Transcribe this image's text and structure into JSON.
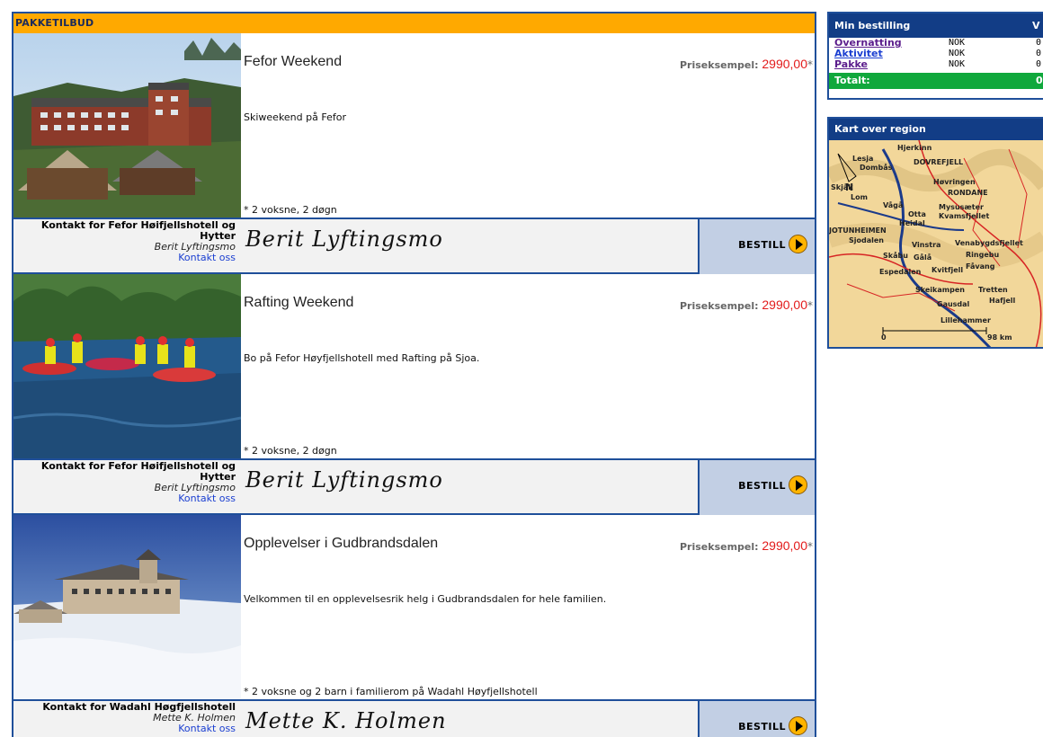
{
  "packages_header": "PAKKETILBUD",
  "packages": [
    {
      "title": "Fefor Weekend",
      "price_label": "Priseksempel:",
      "price_value": "2990,00",
      "price_star": "*",
      "description": "Skiweekend på Fefor",
      "note": "* 2 voksne, 2 døgn",
      "contact_for": "Kontakt for Fefor Høifjellshotell og Hytter",
      "contact_name": "Berit Lyftingsmo",
      "contact_link": "Kontakt oss",
      "signature": "Berit Lyftingsmo",
      "order_label": "BESTILL"
    },
    {
      "title": "Rafting Weekend",
      "price_label": "Priseksempel:",
      "price_value": "2990,00",
      "price_star": "*",
      "description": "Bo på Fefor Høyfjellshotell med Rafting på Sjoa.",
      "note": "* 2 voksne, 2 døgn",
      "contact_for": "Kontakt for Fefor Høifjellshotell og Hytter",
      "contact_name": "Berit Lyftingsmo",
      "contact_link": "Kontakt oss",
      "signature": "Berit Lyftingsmo",
      "order_label": "BESTILL"
    },
    {
      "title": "Opplevelser i Gudbrandsdalen",
      "price_label": "Priseksempel:",
      "price_value": "2990,00",
      "price_star": "*",
      "description": "Velkommen til en opplevelsesrik helg i Gudbrandsdalen for hele familien.",
      "note": "* 2 voksne og 2 barn i familierom på Wadahl Høyfjellshotell",
      "contact_for": "Kontakt for Wadahl Høgfjellshotell",
      "contact_name": "Mette K. Holmen",
      "contact_link": "Kontakt oss",
      "signature": "Mette K. Holmen",
      "order_label": "BESTILL"
    }
  ],
  "order_summary": {
    "title": "Min bestilling",
    "title_cut": "V",
    "rows": [
      {
        "label": "Overnatting",
        "currency": "NOK",
        "amount": "0"
      },
      {
        "label": "Aktivitet",
        "currency": "NOK",
        "amount": "0"
      },
      {
        "label": "Pakke",
        "currency": "NOK",
        "amount": "0"
      }
    ],
    "total_label": "Totalt:",
    "total_amount": "0"
  },
  "map": {
    "title": "Kart over region",
    "places": [
      "Hjerkinn",
      "Lesja",
      "Dombås",
      "DOVREFJELL",
      "Skjåk",
      "Lom",
      "Høvringen",
      "RONDANE",
      "Vågå",
      "Otta",
      "Heidal",
      "Mysusæter",
      "Kvamsfjellet",
      "JOTUNHEIMEN",
      "Sjodalen",
      "Vinstra",
      "Venabygdsfjellet",
      "Skåbu",
      "Gålå",
      "Ringebu",
      "Espedalen",
      "Kvitfjell",
      "Fåvang",
      "Skeikampen",
      "Tretten",
      "Gausdal",
      "Hafjell",
      "Lillehammer"
    ],
    "north": "N",
    "scale_start": "0",
    "scale_end": "98 km"
  },
  "colors": {
    "accent_orange": "#ffa900",
    "navy": "#123d86",
    "border_blue": "#1f4f9a",
    "price_red": "#e21b1b",
    "total_green": "#10a83c"
  }
}
